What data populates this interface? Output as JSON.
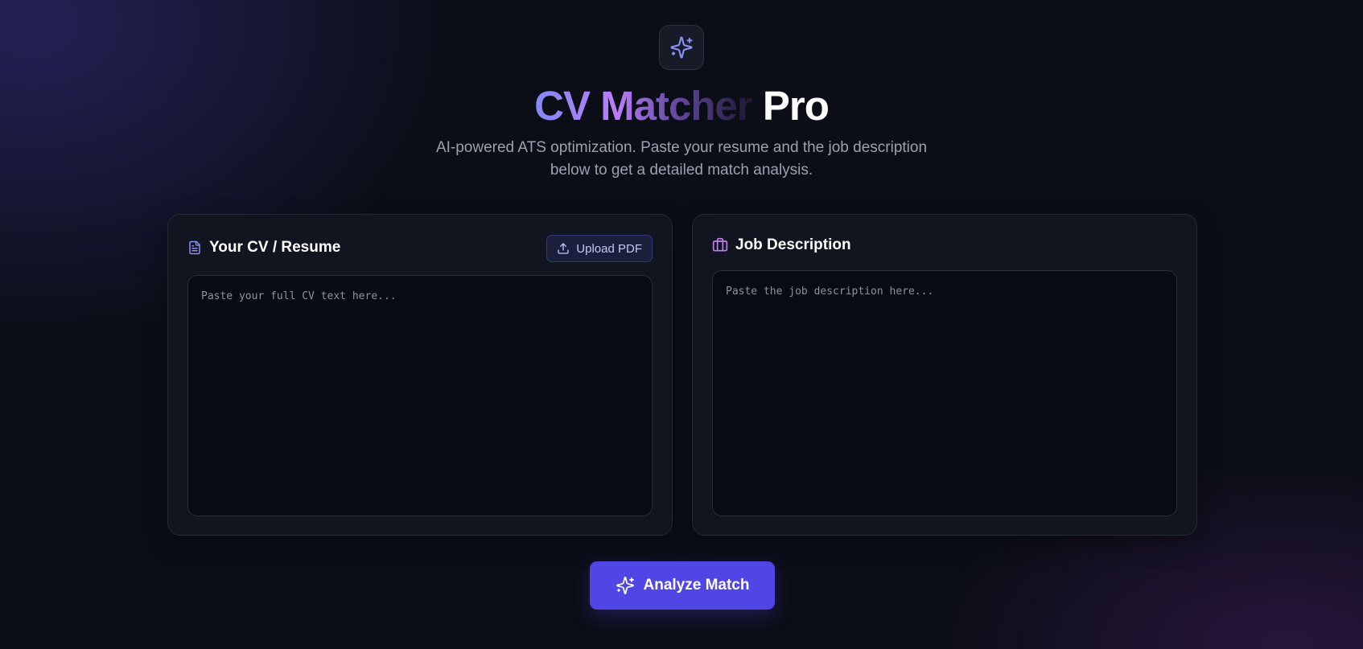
{
  "app": {
    "title_gradient": "CV Matcher",
    "title_plain": "Pro",
    "subtitle": "AI-powered ATS optimization. Paste your resume and the job description below to get a detailed match analysis."
  },
  "cv_card": {
    "title": "Your CV / Resume",
    "upload_label": "Upload PDF",
    "textarea_placeholder": "Paste your full CV text here...",
    "textarea_value": ""
  },
  "job_card": {
    "title": "Job Description",
    "textarea_placeholder": "Paste the job description here...",
    "textarea_value": ""
  },
  "actions": {
    "analyze_label": "Analyze Match"
  },
  "icons": {
    "logo": "sparkles-icon",
    "cv": "document-icon",
    "upload": "upload-icon",
    "job": "briefcase-icon",
    "analyze": "sparkles-icon"
  },
  "colors": {
    "accent": "#4f46e5",
    "title_gradient_start": "#8488f6",
    "title_gradient_mid": "#b97ef6",
    "cv_icon": "#8b8ff5",
    "job_icon": "#c27ef0",
    "background": "#0b0e17"
  }
}
